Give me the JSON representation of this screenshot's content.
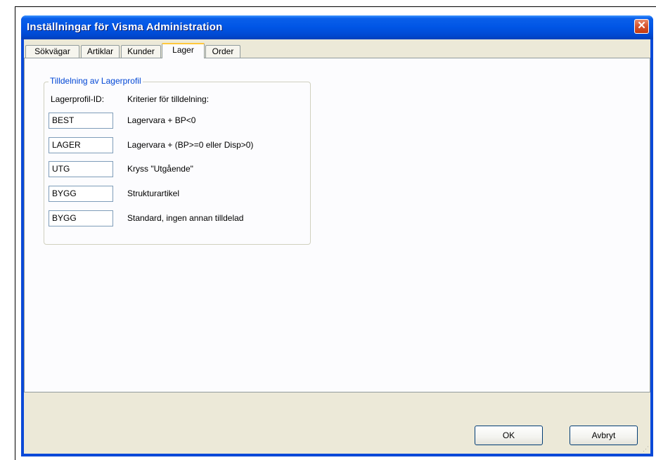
{
  "window": {
    "title": "Inställningar för Visma Administration",
    "close_glyph": "✕"
  },
  "tabs": [
    {
      "label": "Sökvägar"
    },
    {
      "label": "Artiklar"
    },
    {
      "label": "Kunder"
    },
    {
      "label": "Lager",
      "active": true
    },
    {
      "label": "Order"
    }
  ],
  "group": {
    "title": "Tilldelning av Lagerprofil",
    "col_id_header": "Lagerprofil-ID:",
    "col_criteria_header": "Kriterier för tilldelning:",
    "rows": [
      {
        "id": "BEST",
        "criteria": "Lagervara + BP<0"
      },
      {
        "id": "LAGER",
        "criteria": "Lagervara + (BP>=0 eller Disp>0)"
      },
      {
        "id": "UTG",
        "criteria": "Kryss \"Utgående\""
      },
      {
        "id": "BYGG",
        "criteria": "Strukturartikel"
      },
      {
        "id": "BYGG",
        "criteria": "Standard, ingen annan tilldelad"
      }
    ]
  },
  "buttons": {
    "ok": "OK",
    "cancel": "Avbryt"
  },
  "icons": {
    "close": "close-icon",
    "resize": "resize-grip-icon"
  },
  "colors": {
    "titlebar": "#0055e5",
    "group_title": "#0046d5",
    "client_bg": "#ece9d8"
  }
}
